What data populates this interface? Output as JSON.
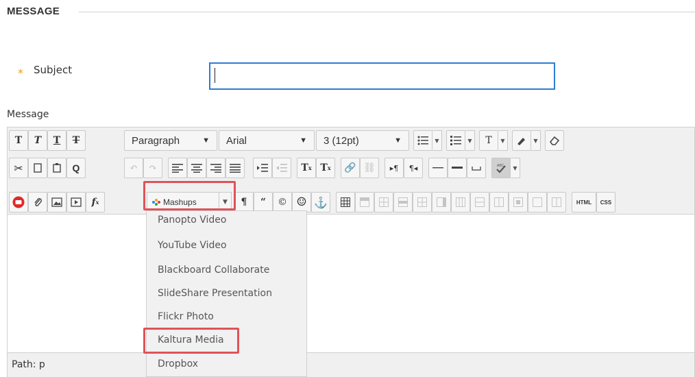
{
  "section": {
    "title": "MESSAGE"
  },
  "subject": {
    "label": "Subject",
    "required_marker": "*",
    "value": ""
  },
  "message": {
    "label": "Message"
  },
  "toolbar": {
    "format_dropdown": "Paragraph",
    "font_dropdown": "Arial",
    "size_dropdown": "3 (12pt)",
    "mashups_label": "Mashups",
    "html_label": "HTML",
    "css_label": "CSS"
  },
  "mashups_menu": {
    "items": [
      "Panopto Video",
      "YouTube Video",
      "Blackboard Collaborate",
      "SlideShare Presentation",
      "Flickr Photo",
      "Kaltura Media",
      "Dropbox"
    ],
    "highlighted_item": "Kaltura Media"
  },
  "status": {
    "path": "Path: p"
  },
  "colors": {
    "accent": "#2c7bd1",
    "highlight": "#e05258",
    "required": "#e89b24"
  },
  "icons": [
    "bold-icon",
    "italic-icon",
    "underline-icon",
    "strikethrough-icon",
    "bullet-list-icon",
    "numbered-list-icon",
    "text-color-icon",
    "highlight-icon",
    "eraser-icon",
    "cut-icon",
    "copy-icon",
    "paste-icon",
    "find-icon",
    "undo-icon",
    "redo-icon",
    "align-left-icon",
    "align-center-icon",
    "align-right-icon",
    "justify-icon",
    "indent-icon",
    "outdent-icon",
    "superscript-icon",
    "subscript-icon",
    "link-icon",
    "unlink-icon",
    "ltr-icon",
    "rtl-icon",
    "hr-icon",
    "thick-hr-icon",
    "nbsp-icon",
    "spellcheck-icon",
    "youtube-icon",
    "attach-icon",
    "image-icon",
    "media-icon",
    "math-icon",
    "mashups-icon",
    "paragraph-mark-icon",
    "quote-icon",
    "copyright-icon",
    "emoticon-icon",
    "anchor-icon",
    "table-icon"
  ]
}
